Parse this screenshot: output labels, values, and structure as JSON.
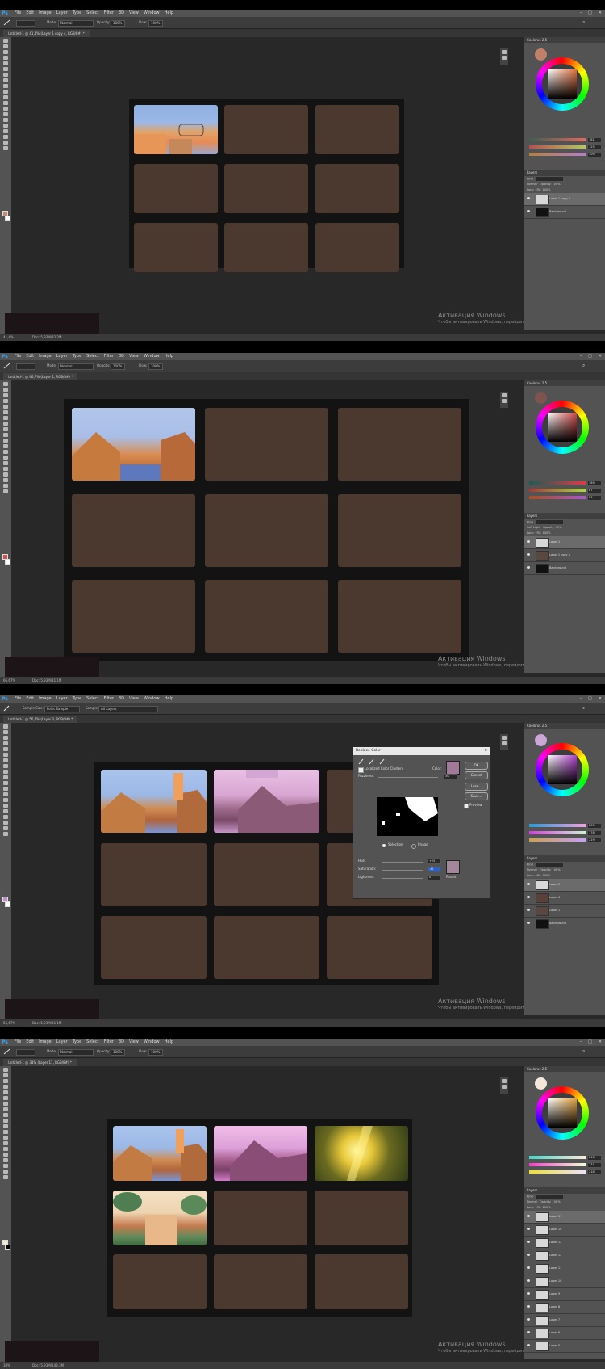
{
  "app": {
    "menu": [
      "File",
      "Edit",
      "Image",
      "Layer",
      "Type",
      "Select",
      "Filter",
      "3D",
      "View",
      "Window",
      "Help"
    ],
    "logo": "Ps"
  },
  "watermark": {
    "line1": "Активация Windows",
    "line2": "Чтобы активировать Windows, перейдите в раздел \"Параметры\"."
  },
  "shots": [
    {
      "tab": "Untitled-1 @ 41,4% (Layer 1 copy 4, RGB/8#) *",
      "mode": "Normal",
      "opacity": "100%",
      "flow": "100%",
      "zoom": "41,4%",
      "doc": "Doc: 5,93M/32,2M",
      "color_title": "Coolorus 2.5",
      "values": [
        "181",
        "125",
        "109"
      ],
      "layers_title": "Layers",
      "blend": "Normal",
      "layer_opacity": "100%",
      "fill": "100%",
      "layers": [
        "Layer 1 copy 4",
        "Background"
      ],
      "selected": 0
    },
    {
      "tab": "Untitled-1 @ 66,7% (Layer 1, RGB/8#) *",
      "mode": "Normal",
      "opacity": "100%",
      "flow": "100%",
      "zoom": "66,67%",
      "doc": "Doc: 5,93M/31,1M",
      "color_title": "Coolorus 2.5",
      "values": [
        "189",
        "87",
        "83"
      ],
      "layers_title": "Layers",
      "blend": "Soft Light",
      "layer_opacity": "49%",
      "fill": "100%",
      "layers": [
        "Layer 1",
        "Layer 1 copy 4",
        "Background"
      ],
      "selected": 0
    },
    {
      "tab": "Untitled-1 @ 56,7% (Layer 3, RGB/8#) *",
      "sample_size_label": "Sample Size:",
      "sample_size": "Point Sample",
      "sample_label": "Sample:",
      "sample": "All Layers",
      "zoom": "56,67%",
      "doc": "Doc: 5,93M/31,1M",
      "color_title": "Coolorus 2.5",
      "values": [
        "205",
        "178",
        "219"
      ],
      "layers_title": "Layers",
      "blend": "Normal",
      "layer_opacity": "100%",
      "fill": "100%",
      "layers": [
        "Layer 3",
        "Layer 4",
        "Layer 1",
        "Background"
      ],
      "selected": 0
    },
    {
      "tab": "Untitled-1 @ 38% (Layer 11, RGB/8#) *",
      "mode": "Normal",
      "opacity": "100%",
      "flow": "100%",
      "zoom": "38%",
      "doc": "Doc: 5,93M/149,3M",
      "color_title": "Coolorus 2.5",
      "values": [
        "246",
        "231",
        "218"
      ],
      "layers_title": "Layers",
      "blend": "Normal",
      "layer_opacity": "100%",
      "fill": "100%",
      "layers": [
        "Layer 11",
        "Layer 10",
        "Layer 12",
        "Layer 12",
        "Layer 11",
        "Layer 10",
        "Layer 9",
        "Layer 8",
        "Layer 7",
        "Layer 6",
        "Layer 5"
      ],
      "selected": 0
    }
  ],
  "dialog": {
    "title": "Replace Color",
    "localized": "Localized Color Clusters",
    "color_label": "Color:",
    "fuzziness_label": "Fuzziness:",
    "fuzziness": "30",
    "selection": "Selection",
    "image": "Image",
    "hue_label": "Hue:",
    "hue": "+25",
    "saturation_label": "Saturation:",
    "saturation": "-41",
    "lightness_label": "Lightness:",
    "lightness": "0",
    "result_label": "Result",
    "ok": "OK",
    "cancel": "Cancel",
    "load": "Load...",
    "save": "Save...",
    "preview": "Preview",
    "sample_color": "#a07a98",
    "result_color": "#a2879a"
  }
}
